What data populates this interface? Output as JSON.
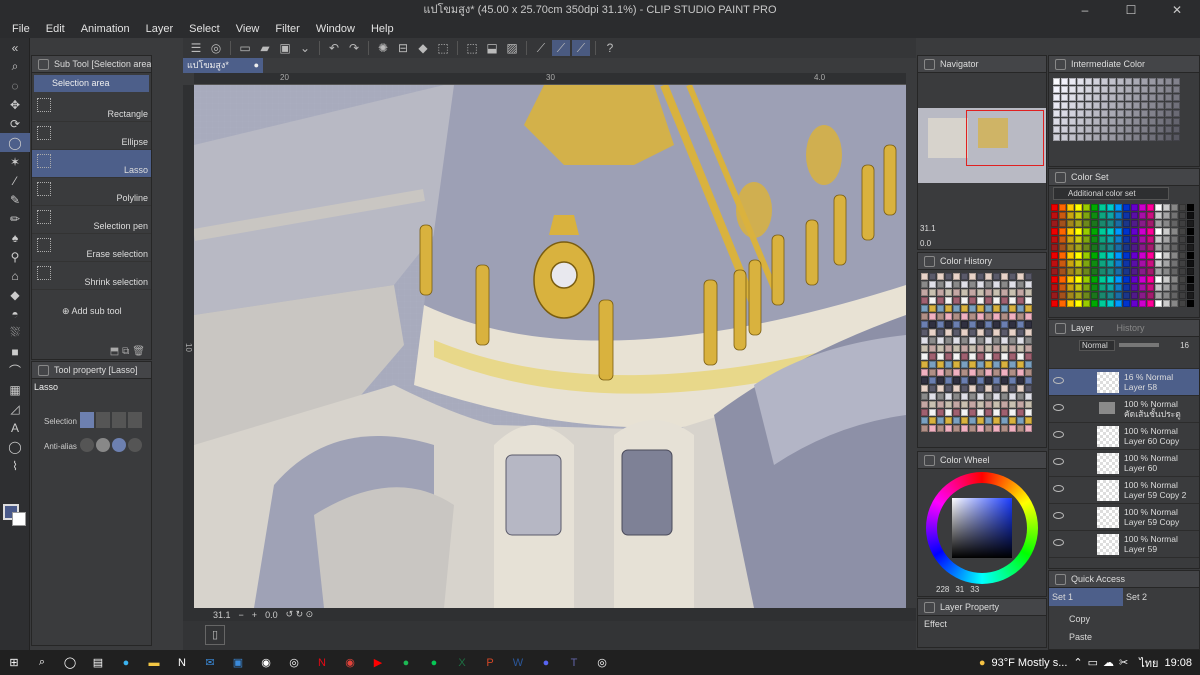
{
  "window": {
    "title": "แปโขมสูง* (45.00 x 25.70cm 350dpi 31.1%) - CLIP STUDIO PAINT PRO"
  },
  "menu": [
    "File",
    "Edit",
    "Animation",
    "Layer",
    "Select",
    "View",
    "Filter",
    "Window",
    "Help"
  ],
  "subtool": {
    "header": "Sub Tool [Selection area]",
    "group": "Selection area",
    "items": [
      {
        "label": "Rectangle",
        "active": false
      },
      {
        "label": "Ellipse",
        "active": false
      },
      {
        "label": "Lasso",
        "active": true
      },
      {
        "label": "Polyline",
        "active": false
      },
      {
        "label": "Selection pen",
        "active": false
      },
      {
        "label": "Erase selection",
        "active": false
      },
      {
        "label": "Shrink selection",
        "active": false
      }
    ],
    "add_label": "Add sub tool"
  },
  "tool_property": {
    "header": "Tool property [Lasso]",
    "tool_name": "Lasso",
    "row1_label": "Selection",
    "row2_label": "Anti-alias"
  },
  "canvas": {
    "tab_label": "แปโขมสูง*",
    "ruler_ticks": [
      "20",
      "30",
      "4.0"
    ],
    "vruler_label": "10",
    "zoom": "31.1",
    "angle": "0.0"
  },
  "navigator": {
    "title": "Navigator",
    "zoom": "31.1",
    "angle": "0.0"
  },
  "color_history": {
    "title": "Color History"
  },
  "color_wheel": {
    "title": "Color Wheel",
    "readout": [
      "228",
      "31",
      "33"
    ]
  },
  "layer_property": {
    "title": "Layer Property",
    "effect_label": "Effect"
  },
  "intermediate": {
    "title": "Intermediate Color"
  },
  "color_set": {
    "title": "Color Set",
    "selected": "Additional color set"
  },
  "layer_panel": {
    "tab_layer": "Layer",
    "tab_history": "History",
    "blend": "Normal",
    "opacity": "16",
    "layers": [
      {
        "line1": "16 % Normal",
        "line2": "Layer 58",
        "active": true,
        "folder": false
      },
      {
        "line1": "100 % Normal",
        "line2": "คัดเส้นชั้นประตู",
        "active": false,
        "folder": true
      },
      {
        "line1": "100 % Normal",
        "line2": "Layer 60 Copy",
        "active": false,
        "folder": false
      },
      {
        "line1": "100 % Normal",
        "line2": "Layer 60",
        "active": false,
        "folder": false
      },
      {
        "line1": "100 % Normal",
        "line2": "Layer 59 Copy 2",
        "active": false,
        "folder": false
      },
      {
        "line1": "100 % Normal",
        "line2": "Layer 59 Copy",
        "active": false,
        "folder": false
      },
      {
        "line1": "100 % Normal",
        "line2": "Layer 59",
        "active": false,
        "folder": false
      }
    ]
  },
  "quick_access": {
    "title": "Quick Access",
    "set1": "Set 1",
    "set2": "Set 2",
    "items": [
      "Copy",
      "Paste"
    ]
  },
  "taskbar": {
    "weather": "93°F  Mostly s...",
    "lang": "ไทย",
    "time": "19:08"
  },
  "colors": {
    "accent": "#4d5f8a",
    "panel": "#3a3b3d",
    "canvas": "#9ca0b8",
    "gold": "#d9b23e"
  }
}
